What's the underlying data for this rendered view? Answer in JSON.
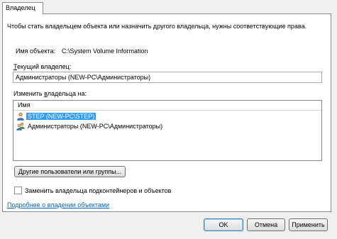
{
  "tab": {
    "label": "Владелец"
  },
  "description": "Чтобы стать владельцем объекта или назначить другого владельца, нужны соответствующие права.",
  "object": {
    "label": "Имя объекта:",
    "value": "C:\\System Volume Information"
  },
  "current_owner": {
    "label_u": "Т",
    "label_rest": "екущий владелец:",
    "value": "Администраторы (NEW-PC\\Администраторы)"
  },
  "change_owner": {
    "label_pre": "Изменить ",
    "label_u": "в",
    "label_rest": "ладельца на:",
    "column_header": "Имя",
    "items": [
      {
        "label": "STEP (NEW-PC\\STEP)",
        "icon": "user-icon",
        "selected": true
      },
      {
        "label": "Администраторы (NEW-PC\\Администраторы)",
        "icon": "group-icon",
        "selected": false
      }
    ]
  },
  "other_users_button": {
    "label": "Другие пользователи или группы..."
  },
  "replace_owner_checkbox": {
    "label": "Заменить владельца подконтейнеров и объектов",
    "checked": false
  },
  "help_link": {
    "label": "Подробнее о владении объектами"
  },
  "buttons": {
    "ok": "OK",
    "cancel": "Отмена",
    "apply": "Применить"
  },
  "colors": {
    "selection": "#3399ff",
    "link": "#0066cc"
  }
}
